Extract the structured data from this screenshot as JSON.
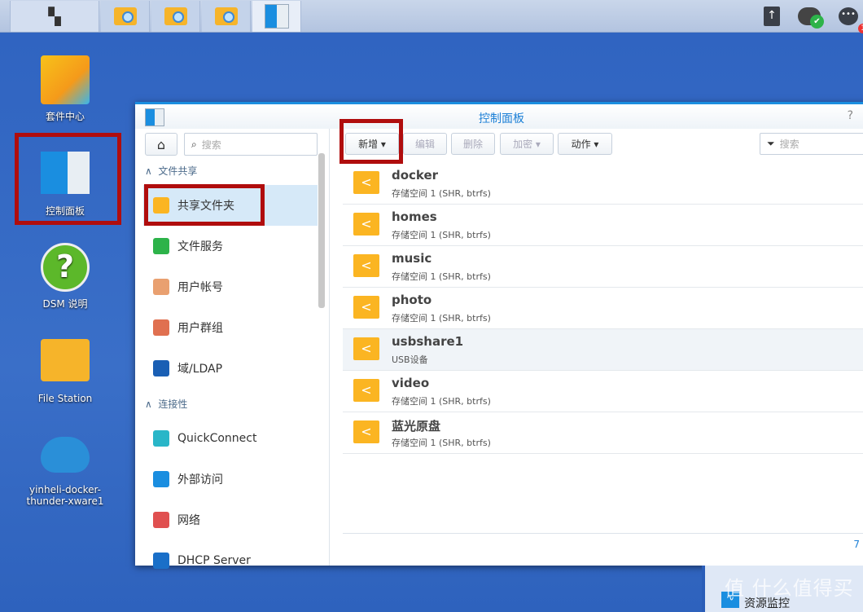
{
  "taskbar": {
    "notification_count": "1",
    "upload_icon": "upload-icon",
    "cloud_icon": "cloud-sync-ok-icon",
    "chat_icon": "chat-icon"
  },
  "desktop": {
    "items": [
      {
        "label": "套件中心"
      },
      {
        "label": "控制面板"
      },
      {
        "label": "DSM 说明"
      },
      {
        "label": "File Station"
      },
      {
        "label": "yinheli-docker-thunder-xware1"
      }
    ]
  },
  "window": {
    "title": "控制面板",
    "help": "?",
    "sidebar": {
      "search_placeholder": "搜索",
      "sections": [
        {
          "title": "文件共享"
        },
        {
          "title": "连接性"
        }
      ],
      "items": [
        {
          "label": "共享文件夹",
          "color": "#fbb522"
        },
        {
          "label": "文件服务",
          "color": "#2db34a"
        },
        {
          "label": "用户帐号",
          "color": "#e9a070"
        },
        {
          "label": "用户群组",
          "color": "#e07050"
        },
        {
          "label": "域/LDAP",
          "color": "#1a5fb4"
        },
        {
          "label": "QuickConnect",
          "color": "#29b6c8"
        },
        {
          "label": "外部访问",
          "color": "#1a8ee0"
        },
        {
          "label": "网络",
          "color": "#e05050"
        },
        {
          "label": "DHCP Server",
          "color": "#1a6fc8"
        }
      ]
    },
    "toolbar": {
      "create": "新增",
      "edit": "编辑",
      "delete": "删除",
      "encrypt": "加密",
      "action": "动作",
      "search_placeholder": "搜索"
    },
    "folders": [
      {
        "name": "docker",
        "desc": "存储空间 1 (SHR, btrfs)"
      },
      {
        "name": "homes",
        "desc": "存储空间 1 (SHR, btrfs)"
      },
      {
        "name": "music",
        "desc": "存储空间 1 (SHR, btrfs)"
      },
      {
        "name": "photo",
        "desc": "存储空间 1 (SHR, btrfs)"
      },
      {
        "name": "usbshare1",
        "desc": "USB设备"
      },
      {
        "name": "video",
        "desc": "存储空间 1 (SHR, btrfs)"
      },
      {
        "name": "蓝光原盘",
        "desc": "存储空间 1 (SHR, btrfs)"
      }
    ],
    "footer_count": "7"
  },
  "widget": {
    "title": "资源监控"
  },
  "watermark": "值 什么值得买",
  "colors": {
    "highlight": "#b00d0d",
    "accent": "#1a8ee0",
    "desktop": "#2f63c0"
  }
}
